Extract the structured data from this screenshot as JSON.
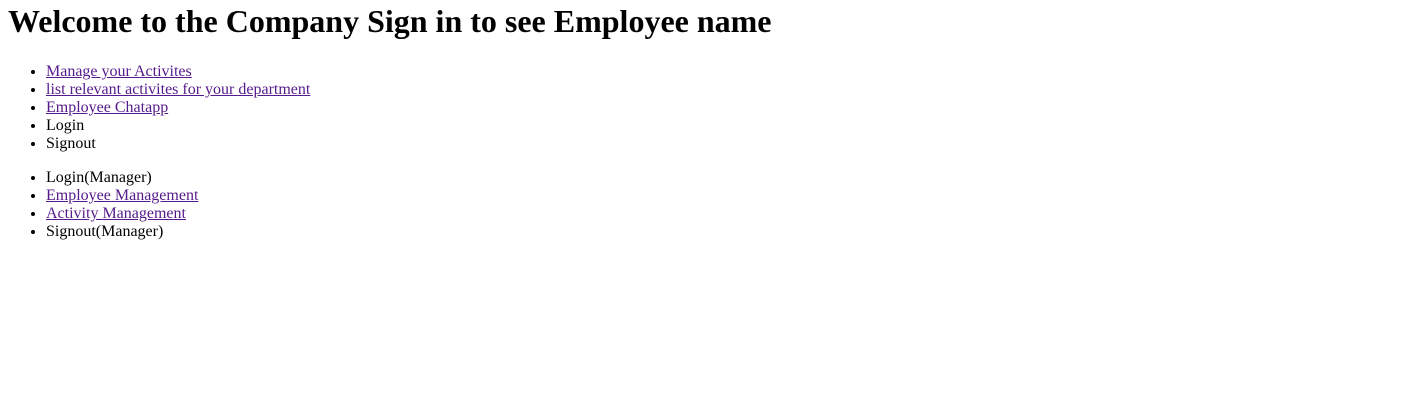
{
  "page": {
    "heading": "Welcome to the Company Sign in to see Employee name"
  },
  "employee_nav": {
    "items": [
      {
        "label": "Manage your Activites",
        "is_link": true
      },
      {
        "label": "list relevant activites for your department",
        "is_link": true
      },
      {
        "label": "Employee Chatapp",
        "is_link": true
      },
      {
        "label": "Login",
        "is_link": false
      },
      {
        "label": "Signout",
        "is_link": false
      }
    ]
  },
  "manager_nav": {
    "items": [
      {
        "label": "Login(Manager)",
        "is_link": false
      },
      {
        "label": "Employee Management",
        "is_link": true
      },
      {
        "label": "Activity Management",
        "is_link": true
      },
      {
        "label": "Signout(Manager)",
        "is_link": false
      }
    ]
  },
  "colors": {
    "visited_link": "#551a8b",
    "text": "#000000",
    "background": "#ffffff"
  }
}
